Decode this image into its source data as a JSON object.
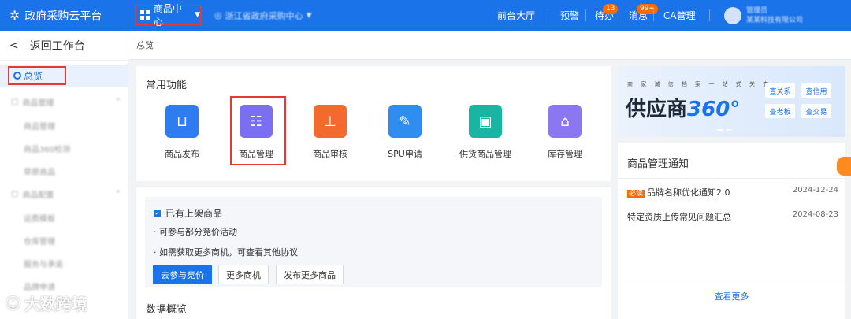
{
  "topbar": {
    "logo": "政府采购云平台",
    "module": "商品中心",
    "org": "浙江省政府采购中心",
    "nav": {
      "front": "前台大厅",
      "warning": "预警",
      "todo": "待办",
      "todo_count": "13",
      "messages": "消息",
      "messages_count": "99+",
      "ca": "CA管理"
    },
    "user_name": "管理员",
    "user_org": "某某科技有限公司"
  },
  "sidebar": {
    "back": "返回工作台",
    "overview": "总览",
    "group1": "商品管理",
    "items1": [
      "商品管理",
      "商品360检测",
      "草原商品"
    ],
    "group2": "商品配置",
    "items2": [
      "运费模板",
      "仓库管理",
      "服务与承诺",
      "品牌申请"
    ]
  },
  "breadcrumb": "总览",
  "functions": {
    "title": "常用功能",
    "items": [
      {
        "label": "商品发布",
        "color": "#2f7bf0"
      },
      {
        "label": "商品管理",
        "color": "#7a6ff0"
      },
      {
        "label": "商品审核",
        "color": "#f26a2e"
      },
      {
        "label": "SPU申请",
        "color": "#2f8df0"
      },
      {
        "label": "供货商品管理",
        "color": "#19b5a2"
      },
      {
        "label": "库存管理",
        "color": "#8b78f0"
      }
    ]
  },
  "promo": {
    "heading": "已有上架商品",
    "line1": "· 可参与部分竞价活动",
    "line2": "· 如需获取更多商机，可查看其他协议",
    "btn_primary": "去参与竞价",
    "btn_more": "更多商机",
    "btn_publish": "发布更多商品"
  },
  "data_title": "数据概览",
  "banner": {
    "slogan": "商 家 诚 信 档 案 一 站 式 关 查",
    "title": "供应商",
    "title_num": "360°",
    "buttons": [
      "查关系",
      "查信用",
      "查老板",
      "查交易"
    ]
  },
  "notice": {
    "title": "商品管理通知",
    "rows": [
      {
        "tag": "必读",
        "text": "品牌名称优化通知2.0",
        "date": "2024-12-24"
      },
      {
        "tag": "",
        "text": "特定资质上传常见问题汇总",
        "date": "2024-08-23"
      }
    ],
    "more": "查看更多"
  },
  "watermark": "大数跨境"
}
